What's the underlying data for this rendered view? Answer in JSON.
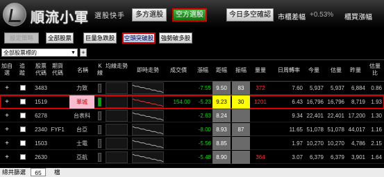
{
  "header": {
    "brand": "順流小軍",
    "subtitle": "選股快手",
    "btn_bull": "多方選股",
    "btn_bear": "空方選股",
    "btn_today": "今日多空確認",
    "market_label": "市櫃差幅",
    "market_value": "+0.53%",
    "fx_label": "櫃買漲幅"
  },
  "toolbar": {
    "set_strategy": "設定策略",
    "all_stocks": "全部股票",
    "sharp_drop": "巨量急跌股",
    "bear_breakout": "空頭突破股",
    "weak_to_strong": "強勢破多股"
  },
  "filter": {
    "select_value": "全部股票標的",
    "plus": "+"
  },
  "columns": {
    "add": "加自選",
    "track": "追蹤",
    "code": "股票代碼",
    "fut_code": "期貨代碼",
    "name": "名稱",
    "k": "K線",
    "ma_trend": "均線走勢",
    "intraday": "即時走勢",
    "price": "成交價",
    "chg": "漲幅",
    "amp_a": "距幅",
    "amp_b": "振幅",
    "vol": "量量",
    "turnover": "日周轉率",
    "today_vol": "今量",
    "est_vol": "估量",
    "prev_vol": "昨量",
    "est_ratio": "估量比"
  },
  "rows": [
    {
      "code": "3483",
      "fut": "",
      "name": "力致",
      "price": "",
      "chg": "-7.55",
      "a": "9.50",
      "b": "83",
      "vol": "372",
      "turnover": "7.60",
      "today": "5,937",
      "est": "5,937",
      "prev": "6,884",
      "ratio": "0.86",
      "highlight": false
    },
    {
      "code": "1519",
      "fut": "",
      "name": "華城",
      "price": "154.00",
      "chg": "-5.23",
      "a": "9.23",
      "b": "30",
      "vol": "1201",
      "turnover": "6.43",
      "today": "16,796",
      "est": "16,796",
      "prev": "8,719",
      "ratio": "1.93",
      "highlight": true
    },
    {
      "code": "6278",
      "fut": "",
      "name": "台表科",
      "price": "",
      "chg": "-2.63",
      "a": "8.24",
      "b": "",
      "vol": "",
      "turnover": "9.34",
      "today": "22,401",
      "est": "22,401",
      "prev": "17,200",
      "ratio": "1.30",
      "highlight": false
    },
    {
      "code": "2340",
      "fut": "FYF1",
      "name": "台亞",
      "price": "",
      "chg": "-8.00",
      "a": "8.93",
      "b": "87",
      "vol": "",
      "turnover": "11.65",
      "today": "51,078",
      "est": "51,078",
      "prev": "44,017",
      "ratio": "1.16",
      "highlight": false
    },
    {
      "code": "1503",
      "fut": "",
      "name": "士電",
      "price": "",
      "chg": "-5.56",
      "a": "8.85",
      "b": "",
      "vol": "",
      "turnover": "1.97",
      "today": "10,270",
      "est": "10,270",
      "prev": "4,786",
      "ratio": "2.15",
      "highlight": false
    },
    {
      "code": "2630",
      "fut": "",
      "name": "亞航",
      "price": "",
      "chg": "-5.48",
      "a": "8.90",
      "b": "",
      "vol": "364",
      "turnover": "3.07",
      "today": "6,379",
      "est": "6,379",
      "prev": "3,901",
      "ratio": "1.64",
      "highlight": false
    }
  ],
  "footer": {
    "label": "總共篩選",
    "count": "65",
    "unit": "檔"
  }
}
